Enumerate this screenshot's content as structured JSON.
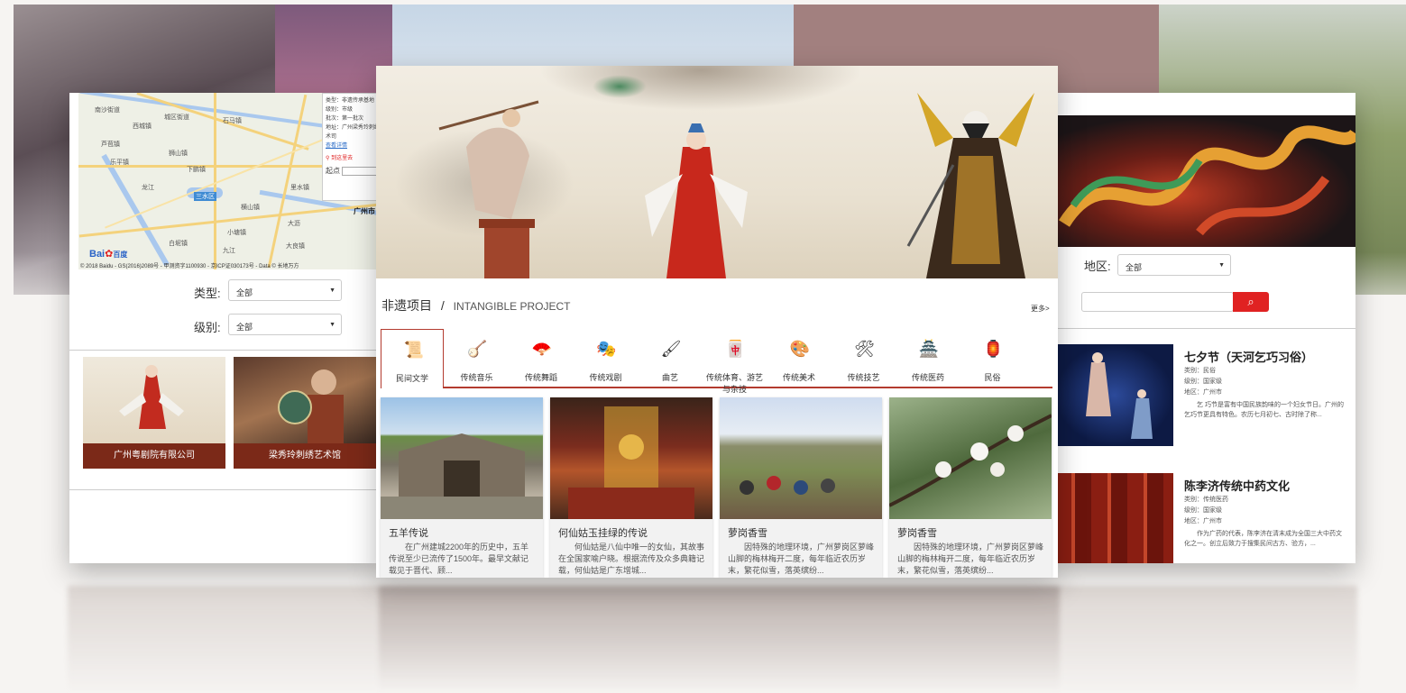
{
  "left_card": {
    "map": {
      "labels": [
        "南沙街道",
        "西城镇",
        "城区街道",
        "石马镇",
        "芦苞镇",
        "狮山镇",
        "乐平镇",
        "下鹏镇",
        "龙江",
        "大沥",
        "三水区",
        "广州市",
        "白坭镇",
        "小塘镇",
        "大良镇",
        "横山镇",
        "里水镇",
        "九江"
      ],
      "info": {
        "type": "类型：非遗传承基地",
        "level": "级别：市级",
        "batch": "批次：第一批次",
        "address": "地址：广州梁秀玲刺绣艺术司",
        "link": "查看详情",
        "route": "到这里去",
        "start": "起点"
      },
      "baidu": "Bai",
      "baidu2": "百度",
      "copyright": "© 2018 Baidu - GS(2016)2089号 - 甲测资字1100930 - 京ICP证030173号 - Data © 长地万方"
    },
    "filter_type_label": "类型:",
    "filter_type_value": "全部",
    "filter_level_label": "级别:",
    "filter_level_value": "全部",
    "tiles": [
      {
        "caption": "广州粤剧院有限公司"
      },
      {
        "caption": "梁秀玲刺绣艺术馆"
      }
    ]
  },
  "center_card": {
    "section_title_cn": "非遗项目",
    "section_sep": "/",
    "section_title_en": "INTANGIBLE PROJECT",
    "more": "更多>",
    "categories": [
      {
        "label": "民间文学",
        "icon": "scroll-icon",
        "glyph": "📜"
      },
      {
        "label": "传统音乐",
        "icon": "instrument-icon",
        "glyph": "🪕"
      },
      {
        "label": "传统舞蹈",
        "icon": "fan-icon",
        "glyph": "🪭"
      },
      {
        "label": "传统戏剧",
        "icon": "opera-mask-icon",
        "glyph": "🎭"
      },
      {
        "label": "曲艺",
        "icon": "brush-icon",
        "glyph": "🖌"
      },
      {
        "label": "传统体育、游艺与杂技",
        "icon": "game-board-icon",
        "glyph": "🀄"
      },
      {
        "label": "传统美术",
        "icon": "paint-icon",
        "glyph": "🎨"
      },
      {
        "label": "传统技艺",
        "icon": "tool-icon",
        "glyph": "🛠"
      },
      {
        "label": "传统医药",
        "icon": "pavilion-icon",
        "glyph": "🏯"
      },
      {
        "label": "民俗",
        "icon": "lion-icon",
        "glyph": "🏮"
      }
    ],
    "items": [
      {
        "title": "五羊传说",
        "desc": "在广州建城2200年的历史中，五羊传说至少已流传了1500年。最早文献记载见于晋代、顾..."
      },
      {
        "title": "何仙姑玉挂绿的传说",
        "desc": "何仙姑是八仙中唯一的女仙，其故事在全国家喻户晓。根据流传及众多典籍记载，何仙姑是广东增城..."
      },
      {
        "title": "萝岗香雪",
        "desc": "因特殊的地理环境，广州萝岗区萝峰山脚的梅林梅开二度，每年临近农历岁末，繁花似雪，落英缤纷..."
      },
      {
        "title": "萝岗香雪",
        "desc": "因特殊的地理环境，广州萝岗区萝峰山脚的梅林梅开二度，每年临近农历岁末，繁花似雪，落英缤纷..."
      }
    ]
  },
  "right_card": {
    "region_label": "地区:",
    "region_value": "全部",
    "search_icon": "search-icon",
    "search_glyph": "⌕",
    "items": [
      {
        "title": "七夕节（天河乞巧习俗）",
        "category": "类别：民俗",
        "level": "级别：国家级",
        "region": "地区：广州市",
        "desc": "乞 巧节是富有中国民族韵味的一个妇女节日。广州的乞巧节更具有特色。农历七月初七、古时除了称..."
      },
      {
        "title": "陈李济传统中药文化",
        "category": "类别：传统医药",
        "level": "级别：国家级",
        "region": "地区：广州市",
        "desc": "作为广药的代表，陈李济在清末成为全国三大中药文化之一。创立后致力于搜集民间古方、验方，..."
      }
    ]
  },
  "colors": {
    "accent": "#b33b2f",
    "search": "#e02222",
    "tile_caption": "#7b2918"
  }
}
